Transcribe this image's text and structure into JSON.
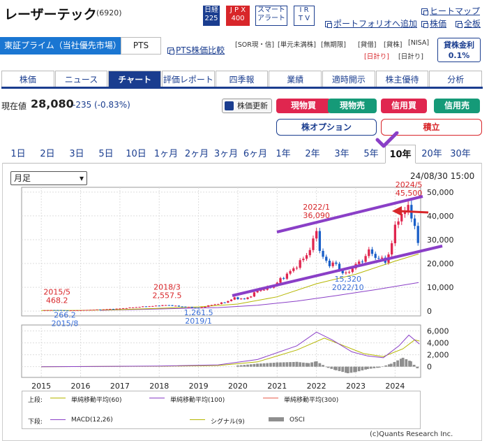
{
  "header": {
    "title": "レーザーテック",
    "code": "(6920)",
    "badges": [
      {
        "line1": "日経",
        "line2": "225"
      },
      {
        "line1": "J P X",
        "line2": "400"
      },
      {
        "line1": "スマート",
        "line2": "アラート"
      },
      {
        "line1": "I R",
        "line2": "T V"
      }
    ],
    "links": {
      "sitemap": "ヒートマップ",
      "portfolio": "ポートフォリオへ追加",
      "stock": "株価",
      "all": "全板",
      "pts_compare": "PTS株価比較"
    },
    "market": "東証プライム（当社優先市場）",
    "pts": "PTS",
    "tags": [
      "[SOR現・信]",
      "[単元未満株]",
      "[無期限]",
      "[貸借]",
      "[貸株]",
      "[NISA]",
      "[日計り]",
      "[日計り]"
    ],
    "lending": {
      "label": "貸株金利",
      "value": "0.1%"
    }
  },
  "tabs": [
    "株価",
    "ニュース",
    "チャート",
    "評価レポート",
    "四季報",
    "業績",
    "適時開示",
    "株主優待",
    "分析"
  ],
  "active_tab": "チャート",
  "price": {
    "label": "現在値",
    "value": "28,080",
    "change": "-235 (-0.83%)",
    "update": "株価更新"
  },
  "buttons": {
    "spot_buy": "現物買",
    "spot_sell": "現物売",
    "margin_buy": "信用買",
    "margin_sell": "信用売",
    "option": "株オプション",
    "accumulate": "積立"
  },
  "colors": {
    "navy": "#1a3d8f",
    "red": "#e0264f",
    "green": "#159a78",
    "purple": "#8a3fc7",
    "arrow_red": "#d8262a"
  },
  "ranges": [
    "1日",
    "2日",
    "3日",
    "5日",
    "10日",
    "1ヶ月",
    "2ヶ月",
    "3ヶ月",
    "6ヶ月",
    "1年",
    "2年",
    "3年",
    "5年",
    "10年",
    "20年",
    "30年"
  ],
  "active_range": "10年",
  "chart": {
    "period_select": "月足",
    "timestamp": "24/08/30 15:00"
  },
  "legend": {
    "upper_label": "上段:",
    "lower_label": "下段:",
    "upper": [
      "単純移動平均(60)",
      "単純移動平均(100)",
      "単純移動平均(300)"
    ],
    "lower": [
      "MACD(12,26)",
      "シグナル(9)",
      "OSCI"
    ]
  },
  "copyright": "(c)Quants Research Inc.",
  "chart_data": [
    {
      "type": "candlestick",
      "x_ticks": [
        "2015",
        "2016",
        "2017",
        "2018",
        "2019",
        "2020",
        "2021",
        "2022",
        "2023",
        "2024"
      ],
      "y_ticks": [
        "50,000",
        "40,000",
        "30,000",
        "20,000",
        "10,000",
        "0"
      ],
      "ylim": [
        -2000,
        52000
      ],
      "x_range": [
        2014.5,
        2024.65
      ],
      "price_series": [
        [
          2015.0,
          400
        ],
        [
          2015.4,
          468
        ],
        [
          2015.6,
          266
        ],
        [
          2016.0,
          400
        ],
        [
          2016.5,
          700
        ],
        [
          2017.0,
          1100
        ],
        [
          2017.5,
          1800
        ],
        [
          2017.9,
          2200
        ],
        [
          2018.2,
          2557
        ],
        [
          2018.5,
          2000
        ],
        [
          2018.8,
          1600
        ],
        [
          2019.0,
          1261
        ],
        [
          2019.3,
          2500
        ],
        [
          2019.7,
          3800
        ],
        [
          2019.9,
          5500
        ],
        [
          2020.2,
          5000
        ],
        [
          2020.5,
          8500
        ],
        [
          2020.9,
          10500
        ],
        [
          2021.1,
          13500
        ],
        [
          2021.4,
          17500
        ],
        [
          2021.7,
          22500
        ],
        [
          2021.9,
          28000
        ],
        [
          2022.0,
          34500
        ],
        [
          2022.1,
          24000
        ],
        [
          2022.3,
          19500
        ],
        [
          2022.45,
          20500
        ],
        [
          2022.6,
          17000
        ],
        [
          2022.8,
          15320
        ],
        [
          2022.95,
          19500
        ],
        [
          2023.15,
          20500
        ],
        [
          2023.3,
          25500
        ],
        [
          2023.45,
          23500
        ],
        [
          2023.6,
          22000
        ],
        [
          2023.75,
          21000
        ],
        [
          2023.9,
          26500
        ],
        [
          2024.0,
          35500
        ],
        [
          2024.1,
          40500
        ],
        [
          2024.2,
          39500
        ],
        [
          2024.35,
          45500
        ],
        [
          2024.45,
          38000
        ],
        [
          2024.55,
          30000
        ],
        [
          2024.62,
          28080
        ]
      ],
      "sma_60": [
        [
          2015,
          250
        ],
        [
          2016,
          320
        ],
        [
          2017,
          650
        ],
        [
          2018,
          1200
        ],
        [
          2019,
          1800
        ],
        [
          2020,
          3000
        ],
        [
          2021,
          6000
        ],
        [
          2022,
          11500
        ],
        [
          2023,
          15500
        ],
        [
          2024,
          21000
        ],
        [
          2024.6,
          24000
        ]
      ],
      "sma_100": [
        [
          2016.5,
          350
        ],
        [
          2017.5,
          700
        ],
        [
          2018.5,
          1100
        ],
        [
          2019.5,
          1500
        ],
        [
          2020.5,
          2500
        ],
        [
          2021.5,
          4200
        ],
        [
          2022.5,
          6500
        ],
        [
          2023.5,
          9000
        ],
        [
          2024.6,
          12000
        ]
      ],
      "annotations": [
        {
          "x": 2015.4,
          "y": 468,
          "text": [
            "2015/5",
            "468.2"
          ],
          "color": "#d8262a"
        },
        {
          "x": 2015.6,
          "y": 266,
          "text": [
            "266.2",
            "2015/8"
          ],
          "color": "#3a6fd8"
        },
        {
          "x": 2018.2,
          "y": 2557,
          "text": [
            "2018/3",
            "2,557.5"
          ],
          "color": "#d8262a"
        },
        {
          "x": 2019.0,
          "y": 1261,
          "text": [
            "1,261.5",
            "2019/1"
          ],
          "color": "#3a6fd8"
        },
        {
          "x": 2022.0,
          "y": 36090,
          "text": [
            "2022/1",
            "36,090"
          ],
          "color": "#d8262a"
        },
        {
          "x": 2022.8,
          "y": 15320,
          "text": [
            "15,320",
            "2022/10"
          ],
          "color": "#3a6fd8"
        },
        {
          "x": 2024.35,
          "y": 45500,
          "text": [
            "2024/5",
            "45,500"
          ],
          "color": "#d8262a"
        }
      ]
    },
    {
      "type": "macd",
      "y_ticks": [
        "6,000",
        "4,000",
        "2,000",
        "0"
      ],
      "ylim": [
        -1800,
        7000
      ],
      "macd": [
        [
          2015,
          0
        ],
        [
          2018,
          100
        ],
        [
          2019.5,
          300
        ],
        [
          2020.5,
          1200
        ],
        [
          2021.5,
          3500
        ],
        [
          2022.0,
          5800
        ],
        [
          2022.4,
          4500
        ],
        [
          2022.9,
          2500
        ],
        [
          2023.3,
          1800
        ],
        [
          2023.7,
          1500
        ],
        [
          2024.1,
          3500
        ],
        [
          2024.35,
          5300
        ],
        [
          2024.62,
          3800
        ]
      ],
      "signal": [
        [
          2015,
          0
        ],
        [
          2018,
          80
        ],
        [
          2019.5,
          200
        ],
        [
          2020.5,
          800
        ],
        [
          2021.5,
          2800
        ],
        [
          2022.2,
          4800
        ],
        [
          2022.7,
          3500
        ],
        [
          2023.2,
          2200
        ],
        [
          2023.7,
          1700
        ],
        [
          2024.2,
          3000
        ],
        [
          2024.5,
          4500
        ],
        [
          2024.62,
          4300
        ]
      ],
      "osci": [
        [
          2020.0,
          200
        ],
        [
          2020.5,
          500
        ],
        [
          2021.0,
          700
        ],
        [
          2021.5,
          800
        ],
        [
          2021.8,
          600
        ],
        [
          2022.0,
          900
        ],
        [
          2022.3,
          -200
        ],
        [
          2022.5,
          -600
        ],
        [
          2022.8,
          -1100
        ],
        [
          2023.0,
          -900
        ],
        [
          2023.3,
          -400
        ],
        [
          2023.6,
          -150
        ],
        [
          2023.9,
          500
        ],
        [
          2024.2,
          1500
        ],
        [
          2024.4,
          900
        ],
        [
          2024.6,
          -500
        ]
      ]
    }
  ]
}
